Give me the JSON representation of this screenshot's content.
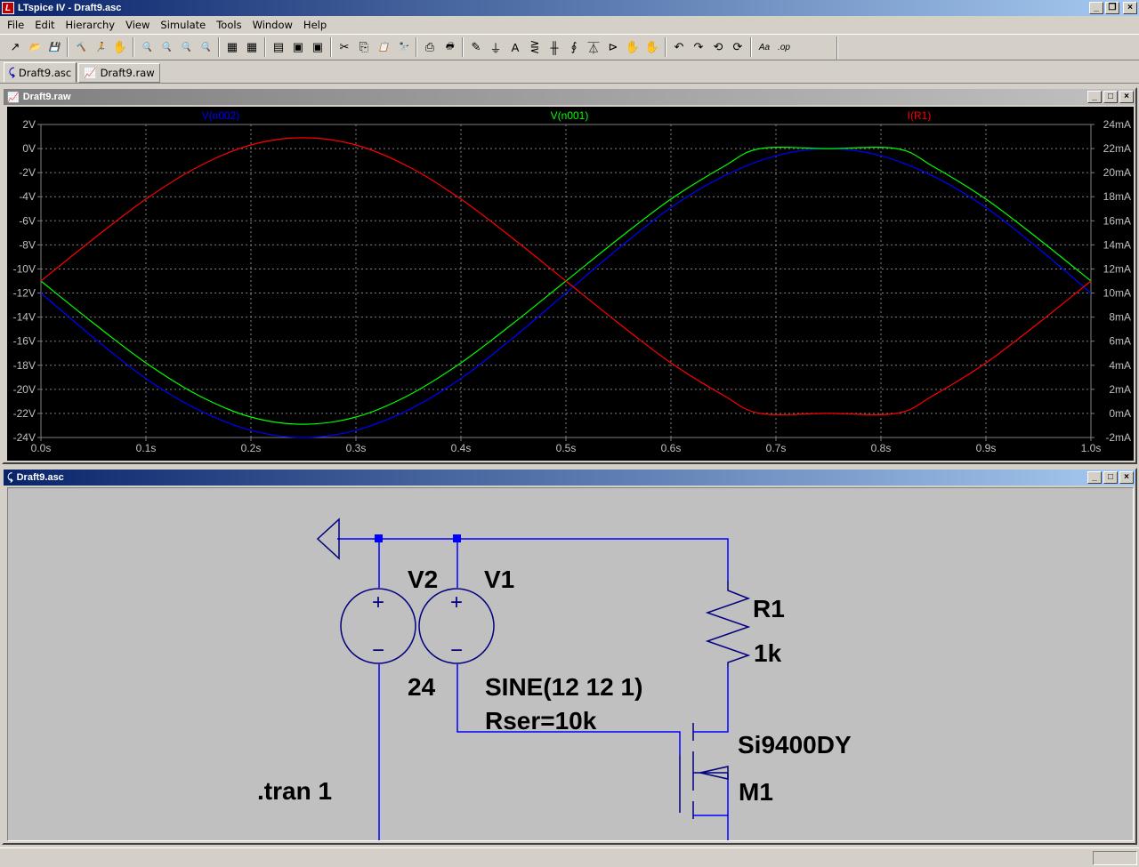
{
  "app": {
    "title": "LTspice IV - Draft9.asc",
    "icon_letter": "L"
  },
  "menu": [
    {
      "label": "File"
    },
    {
      "label": "Edit"
    },
    {
      "label": "Hierarchy"
    },
    {
      "label": "View"
    },
    {
      "label": "Simulate"
    },
    {
      "label": "Tools"
    },
    {
      "label": "Window"
    },
    {
      "label": "Help"
    }
  ],
  "toolbar": [
    {
      "icon": "new-schematic-icon",
      "glyph": "↗"
    },
    {
      "icon": "open-icon",
      "glyph": "📂"
    },
    {
      "icon": "save-icon",
      "glyph": "💾"
    },
    {
      "icon": "control-panel-icon",
      "glyph": "🔨"
    },
    {
      "icon": "run-icon",
      "glyph": "🏃"
    },
    {
      "icon": "halt-icon",
      "glyph": "✋"
    },
    {
      "icon": "zoom-in-icon",
      "glyph": "🔍"
    },
    {
      "icon": "zoom-pan-icon",
      "glyph": "🔍"
    },
    {
      "icon": "zoom-out-icon",
      "glyph": "🔍"
    },
    {
      "icon": "zoom-fit-icon",
      "glyph": "🔍"
    },
    {
      "icon": "autorange-icon",
      "glyph": "▦"
    },
    {
      "icon": "grid-icon",
      "glyph": "▦"
    },
    {
      "icon": "tile-horizontal-icon",
      "glyph": "▤"
    },
    {
      "icon": "cascade-icon",
      "glyph": "▣"
    },
    {
      "icon": "tile-vertical-icon",
      "glyph": "▣"
    },
    {
      "icon": "cut-icon",
      "glyph": "✂"
    },
    {
      "icon": "copy-icon",
      "glyph": "⎘"
    },
    {
      "icon": "paste-icon",
      "glyph": "📋"
    },
    {
      "icon": "find-icon",
      "glyph": "🔭"
    },
    {
      "icon": "print-setup-icon",
      "glyph": "⎙"
    },
    {
      "icon": "print-icon",
      "glyph": "🖶"
    },
    {
      "icon": "wire-icon",
      "glyph": "✎"
    },
    {
      "icon": "ground-icon",
      "glyph": "⏚"
    },
    {
      "icon": "label-net-icon",
      "glyph": "A"
    },
    {
      "icon": "resistor-icon",
      "glyph": "⋛"
    },
    {
      "icon": "capacitor-icon",
      "glyph": "╫"
    },
    {
      "icon": "inductor-icon",
      "glyph": "∮"
    },
    {
      "icon": "diode-icon",
      "glyph": "⏄"
    },
    {
      "icon": "component-icon",
      "glyph": "⊳"
    },
    {
      "icon": "move-icon",
      "glyph": "✋"
    },
    {
      "icon": "drag-icon",
      "glyph": "✋"
    },
    {
      "icon": "undo-icon",
      "glyph": "↶"
    },
    {
      "icon": "redo-icon",
      "glyph": "↷"
    },
    {
      "icon": "rotate-icon",
      "glyph": "⟲"
    },
    {
      "icon": "mirror-icon",
      "glyph": "⟳"
    },
    {
      "icon": "text-icon",
      "glyph": "Aa"
    },
    {
      "icon": "spice-directive-icon",
      "glyph": ".op"
    }
  ],
  "tabs": [
    {
      "label": "Draft9.asc",
      "icon": "schematic-tab-icon"
    },
    {
      "label": "Draft9.raw",
      "icon": "waveform-tab-icon"
    }
  ],
  "wave_window": {
    "title": "Draft9.raw"
  },
  "sch_window": {
    "title": "Draft9.asc"
  },
  "chart_data": {
    "type": "line",
    "x": [
      0.0,
      0.1,
      0.2,
      0.3,
      0.4,
      0.5,
      0.6,
      0.7,
      0.8,
      0.9,
      1.0
    ],
    "x_ticks": [
      "0.0s",
      "0.1s",
      "0.2s",
      "0.3s",
      "0.4s",
      "0.5s",
      "0.6s",
      "0.7s",
      "0.8s",
      "0.9s",
      "1.0s"
    ],
    "xlim": [
      0,
      1.0
    ],
    "y_left_ticks": [
      "2V",
      "0V",
      "-2V",
      "-4V",
      "-6V",
      "-8V",
      "-10V",
      "-12V",
      "-14V",
      "-16V",
      "-18V",
      "-20V",
      "-22V",
      "-24V"
    ],
    "ylim_left": [
      -24,
      2
    ],
    "y_right_ticks": [
      "24mA",
      "22mA",
      "20mA",
      "18mA",
      "16mA",
      "14mA",
      "12mA",
      "10mA",
      "8mA",
      "6mA",
      "4mA",
      "2mA",
      "0mA",
      "-2mA"
    ],
    "ylim_right": [
      -2,
      24
    ],
    "grid": true,
    "series": [
      {
        "name": "V(n002)",
        "color": "#0000ff",
        "axis": "left",
        "x": [
          0.0,
          0.05,
          0.1,
          0.15,
          0.2,
          0.25,
          0.3,
          0.35,
          0.4,
          0.45,
          0.5,
          0.55,
          0.6,
          0.65,
          0.7,
          0.75,
          0.8,
          0.85,
          0.9,
          0.95,
          1.0
        ],
        "values": [
          -12.0,
          -15.7,
          -19.1,
          -21.7,
          -23.4,
          -24.0,
          -23.4,
          -21.7,
          -19.1,
          -15.7,
          -12.0,
          -8.3,
          -4.9,
          -2.3,
          -0.6,
          0.0,
          -0.6,
          -2.3,
          -4.9,
          -8.3,
          -12.0
        ]
      },
      {
        "name": "V(n001)",
        "color": "#00ff00",
        "axis": "left",
        "x": [
          0.0,
          0.05,
          0.1,
          0.15,
          0.2,
          0.25,
          0.3,
          0.35,
          0.4,
          0.45,
          0.5,
          0.55,
          0.6,
          0.65,
          0.685,
          0.75,
          0.815,
          0.85,
          0.9,
          0.95,
          1.0
        ],
        "values": [
          -11.0,
          -14.5,
          -17.8,
          -20.5,
          -22.3,
          -22.9,
          -22.3,
          -20.5,
          -17.8,
          -14.5,
          -11.0,
          -7.5,
          -4.2,
          -1.5,
          0.0,
          0.0,
          0.0,
          -1.5,
          -4.2,
          -7.5,
          -11.0
        ]
      },
      {
        "name": "I(R1)",
        "color": "#ff0000",
        "axis": "right",
        "x": [
          0.0,
          0.05,
          0.1,
          0.15,
          0.2,
          0.25,
          0.3,
          0.35,
          0.4,
          0.45,
          0.5,
          0.55,
          0.6,
          0.65,
          0.685,
          0.75,
          0.815,
          0.85,
          0.9,
          0.95,
          1.0
        ],
        "values": [
          11.0,
          14.5,
          17.8,
          20.5,
          22.3,
          22.9,
          22.3,
          20.5,
          17.8,
          14.5,
          11.0,
          7.5,
          4.2,
          1.5,
          0.0,
          0.0,
          0.0,
          1.5,
          4.2,
          7.5,
          11.0
        ]
      }
    ]
  },
  "schematic": {
    "v2_name": "V2",
    "v2_value": "24",
    "v1_name": "V1",
    "v1_value": "SINE(12 12 1)",
    "v1_rser": "Rser=10k",
    "r1_name": "R1",
    "r1_value": "1k",
    "m1_model": "Si9400DY",
    "m1_name": "M1",
    "directive": ".tran 1",
    "plus": "+",
    "minus": "−",
    "wire_color": "#0000ff",
    "component_color": "#000080"
  }
}
